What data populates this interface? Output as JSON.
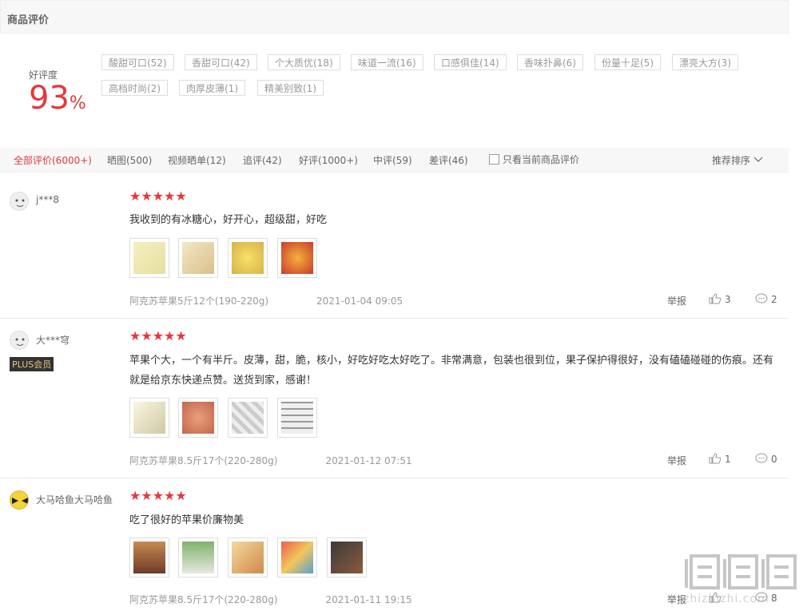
{
  "header": {
    "title": "商品评价"
  },
  "rating": {
    "label": "好评度",
    "value": "93",
    "unit": "%"
  },
  "tags": [
    "酸甜可口(52)",
    "香甜可口(42)",
    "个大质优(18)",
    "味道一流(16)",
    "口感俱佳(14)",
    "香味扑鼻(6)",
    "份量十足(5)",
    "漂亮大方(3)",
    "高档时尚(2)",
    "肉厚皮薄(1)",
    "精美别致(1)"
  ],
  "filters": {
    "tabs": [
      "全部评价(6000+)",
      "晒图(500)",
      "视频晒单(12)",
      "追评(42)",
      "好评(1000+)",
      "中评(59)",
      "差评(46)"
    ],
    "only_current": "只看当前商品评价",
    "sort": "推荐排序"
  },
  "reviews": [
    {
      "user": "j***8",
      "badge": "",
      "stars": "★★★★★",
      "text": "我收到的有冰糖心，好开心，超级甜，好吃",
      "spec": "阿克苏苹果5斤12个(190-220g)",
      "date": "2021-01-04 09:05",
      "report": "举报",
      "likes": "3",
      "replies": "2",
      "images": 4
    },
    {
      "user": "大***穹",
      "badge": "PLUS会员",
      "stars": "★★★★★",
      "text": "苹果个大，一个有半斤。皮薄，甜，脆，核小，好吃好吃太好吃了。非常满意，包装也很到位，果子保护得很好，没有磕磕碰碰的伤痕。还有就是给京东快递点赞。送货到家，感谢！",
      "spec": "阿克苏苹果8.5斤17个(220-280g)",
      "date": "2021-01-12 07:51",
      "report": "举报",
      "likes": "1",
      "replies": "0",
      "images": 4
    },
    {
      "user": "大马哈鱼大马哈鱼",
      "badge": "",
      "stars": "★★★★★",
      "text": "吃了很好的苹果价廉物美",
      "spec": "阿克苏苹果8.5斤17个(220-280g)",
      "date": "2021-01-11 19:15",
      "report": "举报",
      "likes": "",
      "replies": "8",
      "images": 5
    }
  ],
  "watermark": "zhizhizhi.com",
  "colors": {
    "accent": "#e4393c",
    "plus_bg": "#333333",
    "plus_fg": "#e7c57d"
  }
}
